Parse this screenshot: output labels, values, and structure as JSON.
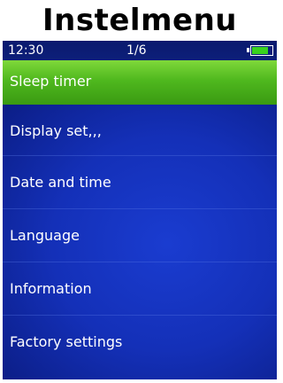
{
  "header": {
    "title": "Instelmenu"
  },
  "status_bar": {
    "time": "12:30",
    "page_indicator": "1/6",
    "battery_level": 0.85,
    "battery_color": "#39d21e"
  },
  "menu": {
    "selected_index": 0,
    "accent_color": "#4fb81e",
    "items": [
      {
        "label": "Sleep timer"
      },
      {
        "label": "Display set,,,"
      },
      {
        "label": "Date and time"
      },
      {
        "label": "Language"
      },
      {
        "label": "Information"
      },
      {
        "label": "Factory settings"
      }
    ]
  }
}
